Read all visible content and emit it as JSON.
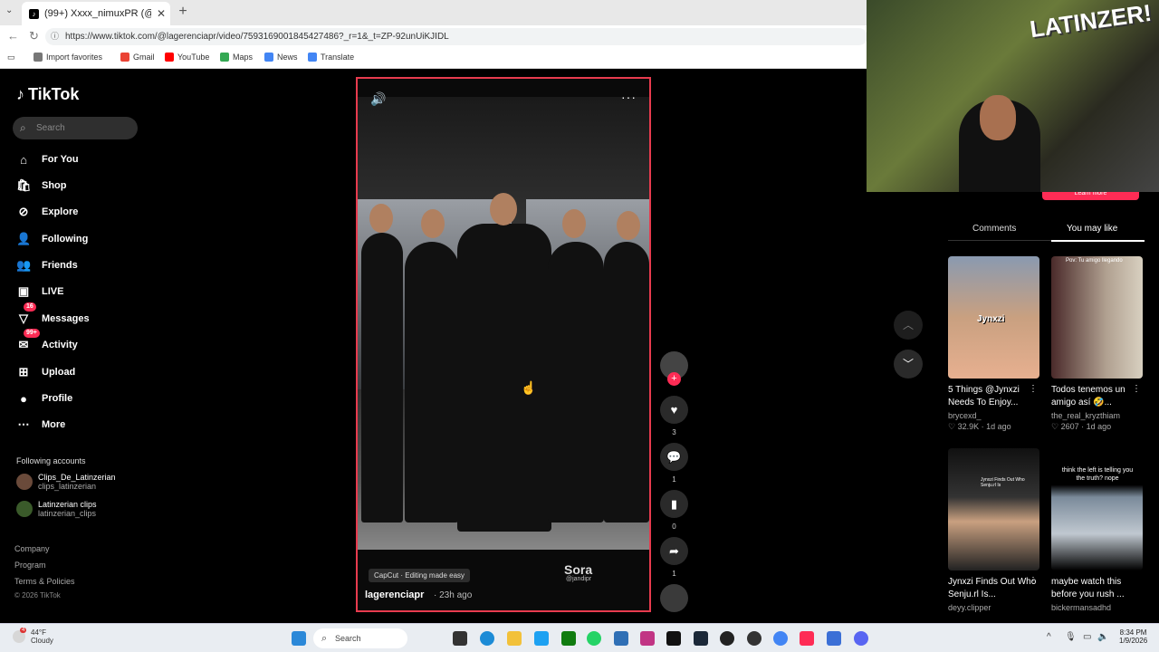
{
  "browser": {
    "tab_title": "(99+) Xxxx_nimuxPR (@lagerenciapr",
    "new_tab": "+",
    "tab_close": "✕",
    "url": "https://www.tiktok.com/@lagerenciapr/video/7593169001845427486?_r=1&_t=ZP-92unUiKJIDL",
    "bookmarks": [
      "Import favorites",
      "Gmail",
      "YouTube",
      "Maps",
      "News",
      "Translate"
    ]
  },
  "sidebar": {
    "logo": "TikTok",
    "search_placeholder": "Search",
    "nav": [
      {
        "label": "For You",
        "icon": "home-icon",
        "glyph": "⌂"
      },
      {
        "label": "Shop",
        "icon": "shop-icon",
        "glyph": "🛍"
      },
      {
        "label": "Explore",
        "icon": "compass-icon",
        "glyph": "⊘"
      },
      {
        "label": "Following",
        "icon": "following-icon",
        "glyph": "👤"
      },
      {
        "label": "Friends",
        "icon": "friends-icon",
        "glyph": "👥"
      },
      {
        "label": "LIVE",
        "icon": "live-icon",
        "glyph": "▣"
      },
      {
        "label": "Messages",
        "icon": "messages-icon",
        "glyph": "▽",
        "badge": "16"
      },
      {
        "label": "Activity",
        "icon": "activity-icon",
        "glyph": "✉",
        "badge": "99+"
      },
      {
        "label": "Upload",
        "icon": "upload-icon",
        "glyph": "⊞"
      },
      {
        "label": "Profile",
        "icon": "profile-icon",
        "glyph": "●"
      },
      {
        "label": "More",
        "icon": "more-icon",
        "glyph": "⋯"
      }
    ],
    "following_title": "Following accounts",
    "accounts": [
      {
        "name": "Clips_De_Latinzerian",
        "handle": "clips_latinzerian"
      },
      {
        "name": "Latinzerian clips",
        "handle": "latinzerian_clips"
      }
    ],
    "footer": [
      "Company",
      "Program",
      "Terms & Policies",
      "© 2026 TikTok"
    ]
  },
  "video": {
    "capcut": "CapCut · Editing made easy",
    "watermark": "Sora",
    "watermark_handle": "@jandipr",
    "author": "lagerenciapr",
    "time": "· 23h ago"
  },
  "actions": {
    "likes": "3",
    "comments": "1",
    "saves": "0",
    "shares": "1"
  },
  "right_panel": {
    "learn_more": "Learn more",
    "tabs": [
      "Comments",
      "You may like"
    ],
    "cards": [
      {
        "title": "5 Things @Jynxzi Needs To Enjoy...",
        "user": "brycexd_",
        "likes": "32.9K",
        "age": "1d ago",
        "overlay": "Jynxzi"
      },
      {
        "title": "Todos tenemos un amigo así 🤣...",
        "user": "the_real_kryzthiam",
        "likes": "2607",
        "age": "1d ago",
        "overlay": "Pov: Tu amigo llegando"
      },
      {
        "title": "Jynxzi Finds Out Who Senju.rl Is...",
        "user": "deyy.clipper",
        "likes": "",
        "age": "",
        "overlay": "Jynxzi Finds Out Who Senju.rl Is"
      },
      {
        "title": "maybe watch this before you rush ...",
        "user": "bickermansadhd",
        "likes": "",
        "age": "",
        "overlay": "think the left is telling you the truth? nope"
      }
    ]
  },
  "webcam": {
    "sign": "LATINZER!"
  },
  "taskbar": {
    "weather_temp": "44°F",
    "weather_cond": "Cloudy",
    "weather_badge": "4",
    "search": "Search",
    "time": "8:34 PM",
    "date": "1/9/2026"
  },
  "colors": {
    "accent": "#fe2c55",
    "video_border": "#e73b4e"
  }
}
